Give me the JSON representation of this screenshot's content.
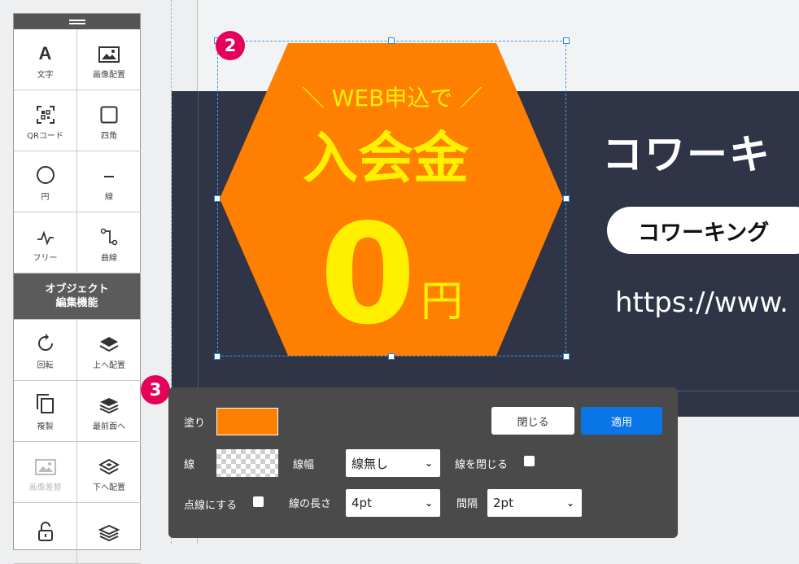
{
  "toolbar": {
    "tools": [
      {
        "label": "文字",
        "icon": "text-icon"
      },
      {
        "label": "画像配置",
        "icon": "image-icon"
      },
      {
        "label": "QRコード",
        "icon": "qr-code-icon"
      },
      {
        "label": "四角",
        "icon": "square-icon"
      },
      {
        "label": "円",
        "icon": "circle-icon"
      },
      {
        "label": "線",
        "icon": "line-icon"
      },
      {
        "label": "フリー",
        "icon": "freehand-icon"
      },
      {
        "label": "曲線",
        "icon": "curve-icon"
      }
    ],
    "section_title": "オブジェクト\n編集機能",
    "edit_tools": [
      {
        "label": "回転",
        "icon": "rotate-icon"
      },
      {
        "label": "上へ配置",
        "icon": "layer-up-icon"
      },
      {
        "label": "複製",
        "icon": "duplicate-icon"
      },
      {
        "label": "最前面へ",
        "icon": "bring-front-icon"
      },
      {
        "label": "画像差替",
        "icon": "image-replace-icon",
        "disabled": true
      },
      {
        "label": "下へ配置",
        "icon": "layer-down-icon"
      },
      {
        "label": "",
        "icon": "unlock-icon"
      },
      {
        "label": "",
        "icon": "send-back-icon"
      }
    ]
  },
  "canvas": {
    "hexagon": {
      "tagline": "＼ WEB申込で ／",
      "headline": "入会金",
      "big_number": "0",
      "unit": "円",
      "fill_color": "#ff7f00",
      "text_color": "#fff000"
    },
    "banner": {
      "title": "コワーキ",
      "pill_text": "コワーキング",
      "url": "https://www."
    }
  },
  "badges": {
    "step2": "2",
    "step3": "3"
  },
  "panel": {
    "fill_label": "塗り",
    "fill_color": "#ff7f00",
    "close_button": "閉じる",
    "apply_button": "適用",
    "stroke_label": "線",
    "stroke_width_label": "線幅",
    "stroke_width_value": "線無し",
    "close_path_label": "線を閉じる",
    "dotted_label": "点線にする",
    "dash_length_label": "線の長さ",
    "dash_length_value": "4pt",
    "gap_label": "間隔",
    "gap_value": "2pt"
  }
}
